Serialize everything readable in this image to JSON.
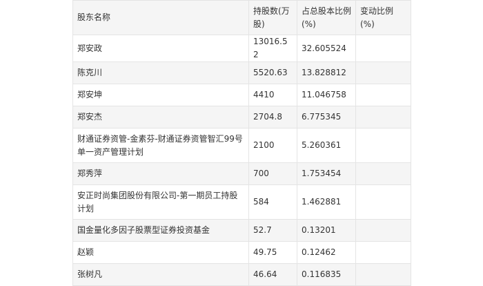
{
  "table": {
    "headers": {
      "name": "股东名称",
      "shares": "持股数(万股)",
      "ratio": "占总股本比例(%)",
      "change": "变动比例(%)"
    },
    "rows": [
      {
        "name": "郑安政",
        "shares": "13016.52",
        "ratio": "32.605524",
        "change": ""
      },
      {
        "name": "陈克川",
        "shares": "5520.63",
        "ratio": "13.828812",
        "change": ""
      },
      {
        "name": "郑安坤",
        "shares": "4410",
        "ratio": "11.046758",
        "change": ""
      },
      {
        "name": "郑安杰",
        "shares": "2704.8",
        "ratio": "6.775345",
        "change": ""
      },
      {
        "name": "财通证券资管-金素芬-财通证券资管智汇99号单一资产管理计划",
        "shares": "2100",
        "ratio": "5.260361",
        "change": ""
      },
      {
        "name": "郑秀萍",
        "shares": "700",
        "ratio": "1.753454",
        "change": ""
      },
      {
        "name": "安正时尚集团股份有限公司-第一期员工持股计划",
        "shares": "584",
        "ratio": "1.462881",
        "change": ""
      },
      {
        "name": "国金量化多因子股票型证券投资基金",
        "shares": "52.7",
        "ratio": "0.13201",
        "change": ""
      },
      {
        "name": "赵颖",
        "shares": "49.75",
        "ratio": "0.12462",
        "change": ""
      },
      {
        "name": "张树凡",
        "shares": "46.64",
        "ratio": "0.116835",
        "change": ""
      }
    ]
  }
}
